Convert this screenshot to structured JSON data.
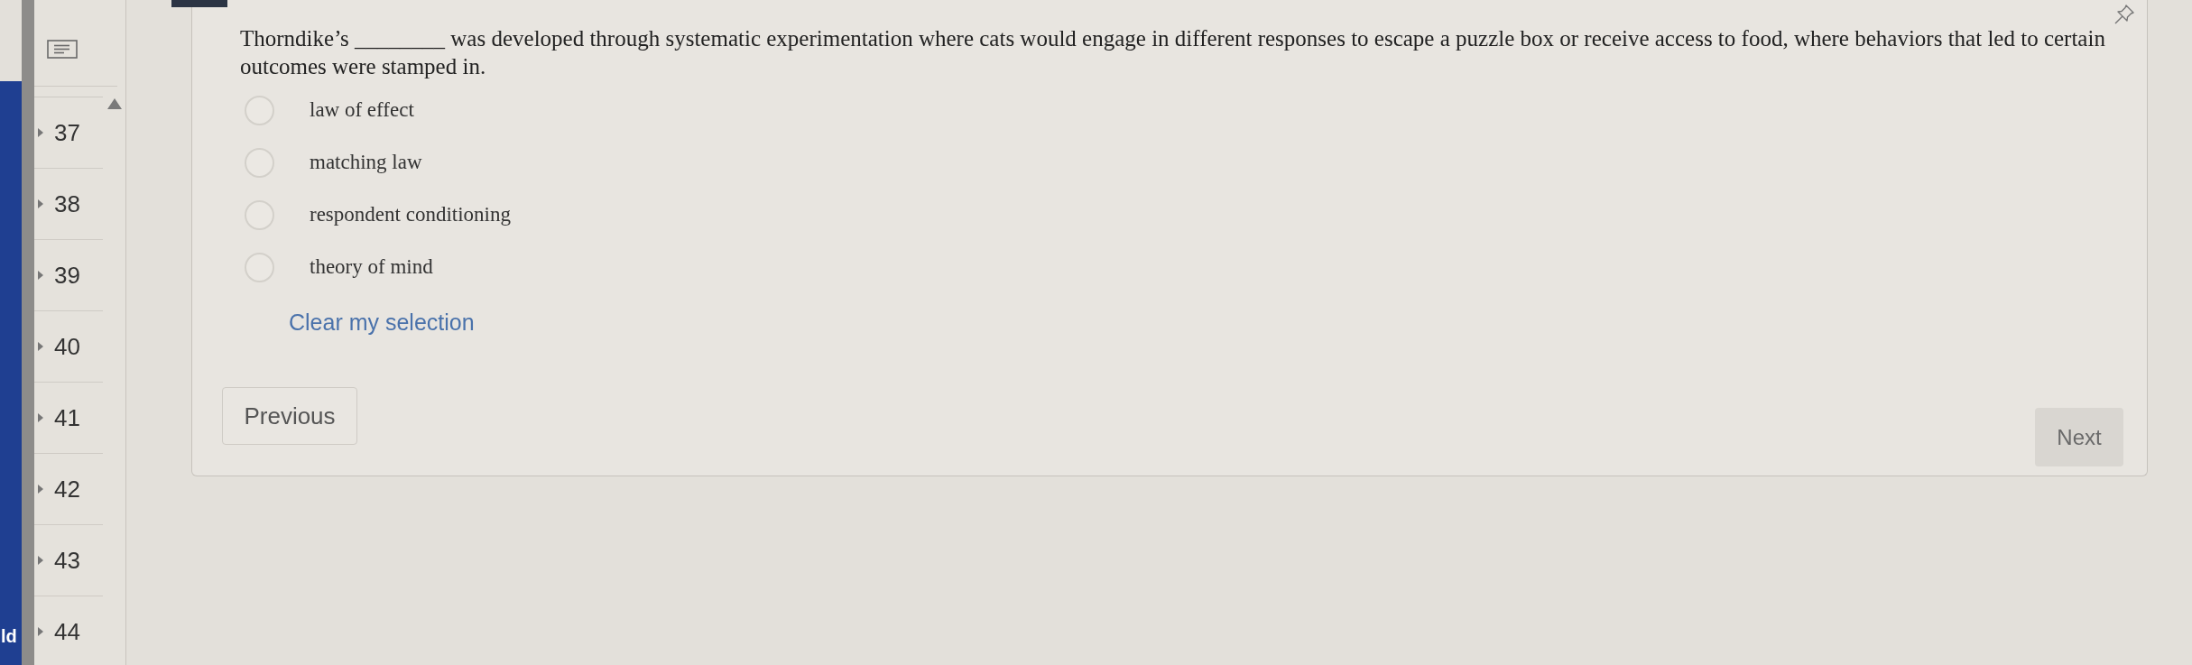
{
  "app_edge": {
    "label": "ld"
  },
  "sidebar": {
    "items": [
      {
        "label": "37"
      },
      {
        "label": "38"
      },
      {
        "label": "39"
      },
      {
        "label": "40"
      },
      {
        "label": "41"
      },
      {
        "label": "42"
      },
      {
        "label": "43"
      },
      {
        "label": "44"
      }
    ]
  },
  "question": {
    "text": "Thorndike’s ________ was developed through systematic experimentation where cats would engage in different responses to escape a puzzle box or receive access to food, where behaviors that led to certain outcomes were stamped in.",
    "options": [
      {
        "label": "law of effect",
        "selected": false
      },
      {
        "label": "matching law",
        "selected": false
      },
      {
        "label": "respondent conditioning",
        "selected": false
      },
      {
        "label": "theory of mind",
        "selected": false
      }
    ],
    "clear_link": "Clear my selection"
  },
  "navigation": {
    "previous": "Previous",
    "next": "Next"
  }
}
